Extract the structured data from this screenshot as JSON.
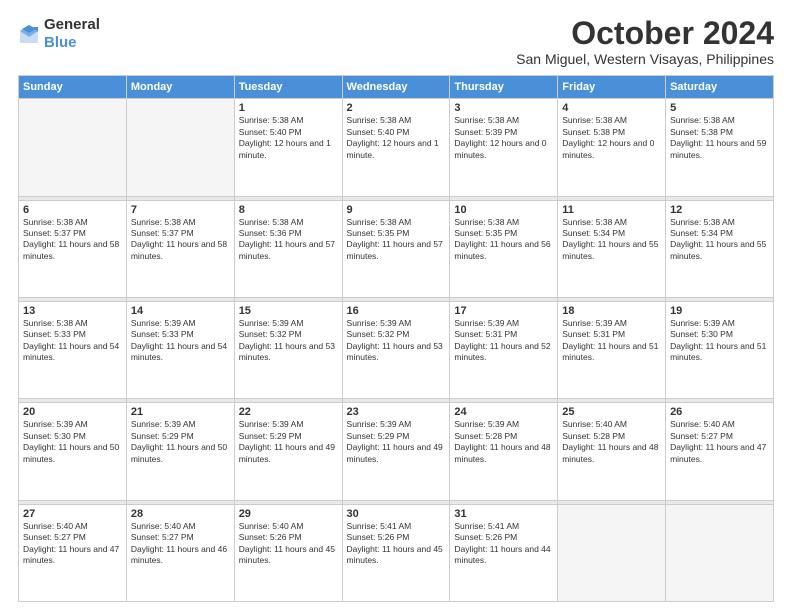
{
  "logo": {
    "general": "General",
    "blue": "Blue"
  },
  "header": {
    "month": "October 2024",
    "location": "San Miguel, Western Visayas, Philippines"
  },
  "weekdays": [
    "Sunday",
    "Monday",
    "Tuesday",
    "Wednesday",
    "Thursday",
    "Friday",
    "Saturday"
  ],
  "weeks": [
    [
      {
        "day": "",
        "sunrise": "",
        "sunset": "",
        "daylight": ""
      },
      {
        "day": "",
        "sunrise": "",
        "sunset": "",
        "daylight": ""
      },
      {
        "day": "1",
        "sunrise": "Sunrise: 5:38 AM",
        "sunset": "Sunset: 5:40 PM",
        "daylight": "Daylight: 12 hours and 1 minute."
      },
      {
        "day": "2",
        "sunrise": "Sunrise: 5:38 AM",
        "sunset": "Sunset: 5:40 PM",
        "daylight": "Daylight: 12 hours and 1 minute."
      },
      {
        "day": "3",
        "sunrise": "Sunrise: 5:38 AM",
        "sunset": "Sunset: 5:39 PM",
        "daylight": "Daylight: 12 hours and 0 minutes."
      },
      {
        "day": "4",
        "sunrise": "Sunrise: 5:38 AM",
        "sunset": "Sunset: 5:38 PM",
        "daylight": "Daylight: 12 hours and 0 minutes."
      },
      {
        "day": "5",
        "sunrise": "Sunrise: 5:38 AM",
        "sunset": "Sunset: 5:38 PM",
        "daylight": "Daylight: 11 hours and 59 minutes."
      }
    ],
    [
      {
        "day": "6",
        "sunrise": "Sunrise: 5:38 AM",
        "sunset": "Sunset: 5:37 PM",
        "daylight": "Daylight: 11 hours and 58 minutes."
      },
      {
        "day": "7",
        "sunrise": "Sunrise: 5:38 AM",
        "sunset": "Sunset: 5:37 PM",
        "daylight": "Daylight: 11 hours and 58 minutes."
      },
      {
        "day": "8",
        "sunrise": "Sunrise: 5:38 AM",
        "sunset": "Sunset: 5:36 PM",
        "daylight": "Daylight: 11 hours and 57 minutes."
      },
      {
        "day": "9",
        "sunrise": "Sunrise: 5:38 AM",
        "sunset": "Sunset: 5:35 PM",
        "daylight": "Daylight: 11 hours and 57 minutes."
      },
      {
        "day": "10",
        "sunrise": "Sunrise: 5:38 AM",
        "sunset": "Sunset: 5:35 PM",
        "daylight": "Daylight: 11 hours and 56 minutes."
      },
      {
        "day": "11",
        "sunrise": "Sunrise: 5:38 AM",
        "sunset": "Sunset: 5:34 PM",
        "daylight": "Daylight: 11 hours and 55 minutes."
      },
      {
        "day": "12",
        "sunrise": "Sunrise: 5:38 AM",
        "sunset": "Sunset: 5:34 PM",
        "daylight": "Daylight: 11 hours and 55 minutes."
      }
    ],
    [
      {
        "day": "13",
        "sunrise": "Sunrise: 5:38 AM",
        "sunset": "Sunset: 5:33 PM",
        "daylight": "Daylight: 11 hours and 54 minutes."
      },
      {
        "day": "14",
        "sunrise": "Sunrise: 5:39 AM",
        "sunset": "Sunset: 5:33 PM",
        "daylight": "Daylight: 11 hours and 54 minutes."
      },
      {
        "day": "15",
        "sunrise": "Sunrise: 5:39 AM",
        "sunset": "Sunset: 5:32 PM",
        "daylight": "Daylight: 11 hours and 53 minutes."
      },
      {
        "day": "16",
        "sunrise": "Sunrise: 5:39 AM",
        "sunset": "Sunset: 5:32 PM",
        "daylight": "Daylight: 11 hours and 53 minutes."
      },
      {
        "day": "17",
        "sunrise": "Sunrise: 5:39 AM",
        "sunset": "Sunset: 5:31 PM",
        "daylight": "Daylight: 11 hours and 52 minutes."
      },
      {
        "day": "18",
        "sunrise": "Sunrise: 5:39 AM",
        "sunset": "Sunset: 5:31 PM",
        "daylight": "Daylight: 11 hours and 51 minutes."
      },
      {
        "day": "19",
        "sunrise": "Sunrise: 5:39 AM",
        "sunset": "Sunset: 5:30 PM",
        "daylight": "Daylight: 11 hours and 51 minutes."
      }
    ],
    [
      {
        "day": "20",
        "sunrise": "Sunrise: 5:39 AM",
        "sunset": "Sunset: 5:30 PM",
        "daylight": "Daylight: 11 hours and 50 minutes."
      },
      {
        "day": "21",
        "sunrise": "Sunrise: 5:39 AM",
        "sunset": "Sunset: 5:29 PM",
        "daylight": "Daylight: 11 hours and 50 minutes."
      },
      {
        "day": "22",
        "sunrise": "Sunrise: 5:39 AM",
        "sunset": "Sunset: 5:29 PM",
        "daylight": "Daylight: 11 hours and 49 minutes."
      },
      {
        "day": "23",
        "sunrise": "Sunrise: 5:39 AM",
        "sunset": "Sunset: 5:29 PM",
        "daylight": "Daylight: 11 hours and 49 minutes."
      },
      {
        "day": "24",
        "sunrise": "Sunrise: 5:39 AM",
        "sunset": "Sunset: 5:28 PM",
        "daylight": "Daylight: 11 hours and 48 minutes."
      },
      {
        "day": "25",
        "sunrise": "Sunrise: 5:40 AM",
        "sunset": "Sunset: 5:28 PM",
        "daylight": "Daylight: 11 hours and 48 minutes."
      },
      {
        "day": "26",
        "sunrise": "Sunrise: 5:40 AM",
        "sunset": "Sunset: 5:27 PM",
        "daylight": "Daylight: 11 hours and 47 minutes."
      }
    ],
    [
      {
        "day": "27",
        "sunrise": "Sunrise: 5:40 AM",
        "sunset": "Sunset: 5:27 PM",
        "daylight": "Daylight: 11 hours and 47 minutes."
      },
      {
        "day": "28",
        "sunrise": "Sunrise: 5:40 AM",
        "sunset": "Sunset: 5:27 PM",
        "daylight": "Daylight: 11 hours and 46 minutes."
      },
      {
        "day": "29",
        "sunrise": "Sunrise: 5:40 AM",
        "sunset": "Sunset: 5:26 PM",
        "daylight": "Daylight: 11 hours and 45 minutes."
      },
      {
        "day": "30",
        "sunrise": "Sunrise: 5:41 AM",
        "sunset": "Sunset: 5:26 PM",
        "daylight": "Daylight: 11 hours and 45 minutes."
      },
      {
        "day": "31",
        "sunrise": "Sunrise: 5:41 AM",
        "sunset": "Sunset: 5:26 PM",
        "daylight": "Daylight: 11 hours and 44 minutes."
      },
      {
        "day": "",
        "sunrise": "",
        "sunset": "",
        "daylight": ""
      },
      {
        "day": "",
        "sunrise": "",
        "sunset": "",
        "daylight": ""
      }
    ]
  ]
}
